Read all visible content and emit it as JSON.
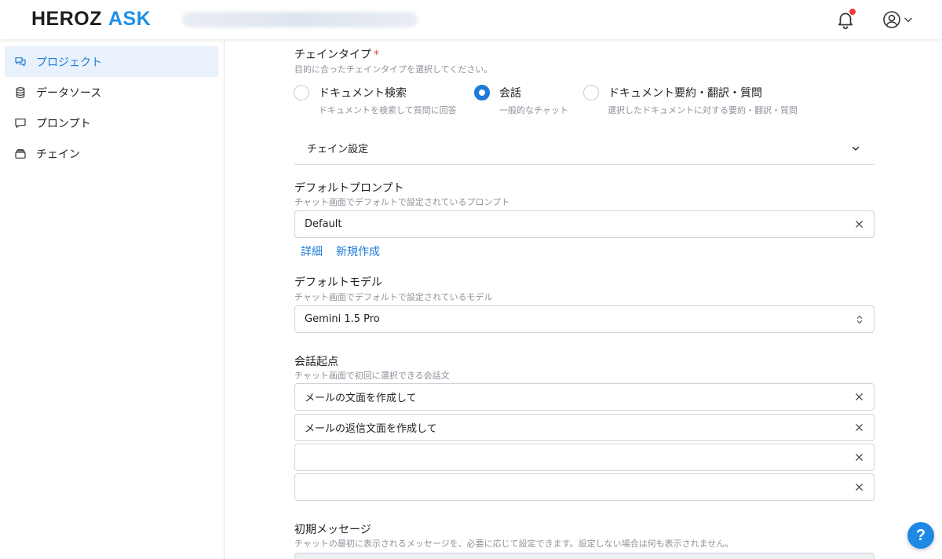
{
  "header": {
    "logo_primary": "HEROZ",
    "logo_secondary": "ASK",
    "icons": {
      "notifications": "bell-icon",
      "account": "user-circle-icon",
      "account_menu": "chevron-down-icon"
    },
    "colors": {
      "brand": "#1e90e6",
      "notification_dot": "#ef3b3b"
    }
  },
  "sidebar": {
    "items": [
      {
        "label": "プロジェクト",
        "icon": "chat-bubbles-icon",
        "active": true
      },
      {
        "label": "データソース",
        "icon": "database-icon",
        "active": false
      },
      {
        "label": "プロンプト",
        "icon": "message-icon",
        "active": false
      },
      {
        "label": "チェイン",
        "icon": "stack-icon",
        "active": false
      }
    ]
  },
  "chain_type": {
    "label": "チェインタイプ",
    "required_mark": "*",
    "description": "目的に合ったチェインタイプを選択してください。",
    "options": [
      {
        "label": "ドキュメント検索",
        "desc": "ドキュメントを検索して質問に回答",
        "selected": false
      },
      {
        "label": "会話",
        "desc": "一般的なチャット",
        "selected": true
      },
      {
        "label": "ドキュメント要約・翻訳・質問",
        "desc": "選択したドキュメントに対する要約・翻訳・質問",
        "selected": false
      }
    ]
  },
  "chain_settings": {
    "label": "チェイン設定"
  },
  "default_prompt": {
    "label": "デフォルトプロンプト",
    "description": "チャット画面でデフォルトで設定されているプロンプト",
    "value": "Default",
    "links": {
      "detail": "詳細",
      "create_new": "新規作成"
    }
  },
  "default_model": {
    "label": "デフォルトモデル",
    "description": "チャット画面でデフォルトで設定されているモデル",
    "value": "Gemini 1.5 Pro"
  },
  "conversation_starters": {
    "label": "会話起点",
    "description": "チャット画面で初回に選択できる会話文",
    "values": [
      "メールの文面を作成して",
      "メールの返信文面を作成して",
      "",
      ""
    ]
  },
  "initial_message": {
    "label": "初期メッセージ",
    "description": "チャットの最初に表示されるメッセージを、必要に応じて設定できます。設定しない場合は何も表示されません。"
  },
  "help": {
    "label": "?"
  }
}
